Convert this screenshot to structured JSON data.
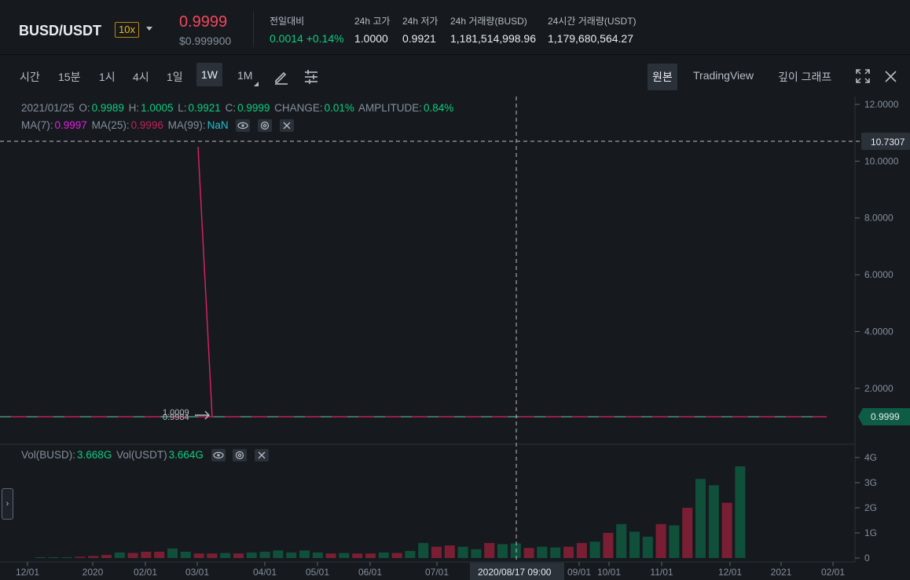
{
  "header": {
    "symbol": "BUSD/USDT",
    "leverage": "10x",
    "last_price": "0.9999",
    "usd_price": "$0.999900",
    "stats": [
      {
        "label": "전일대비",
        "value": "0.0014 +0.14%",
        "color": "#0ecb81"
      },
      {
        "label": "24h 고가",
        "value": "1.0000"
      },
      {
        "label": "24h 저가",
        "value": "0.9921"
      },
      {
        "label": "24h 거래량(BUSD)",
        "value": "1,181,514,998.96"
      },
      {
        "label": "24시간 거래량(USDT)",
        "value": "1,179,680,564.27"
      }
    ]
  },
  "toolbar": {
    "intervals": [
      "시간",
      "15분",
      "1시",
      "4시",
      "1일",
      "1W",
      "1M"
    ],
    "active_interval": "1W",
    "views": [
      "원본",
      "TradingView",
      "깊이 그래프"
    ],
    "active_view": "원본"
  },
  "ohlc": {
    "date": "2021/01/25",
    "o_label": "O:",
    "o": "0.9989",
    "h_label": "H:",
    "h": "1.0005",
    "l_label": "L:",
    "l": "0.9921",
    "c_label": "C:",
    "c": "0.9999",
    "change_label": "CHANGE:",
    "change": "0.01%",
    "amp_label": "AMPLITUDE:",
    "amp": "0.84%"
  },
  "ma": {
    "ma7_label": "MA(7):",
    "ma7": "0.9997",
    "ma7_color": "#e020e0",
    "ma25_label": "MA(25):",
    "ma25": "0.9996",
    "ma25_color": "#c0205a",
    "ma99_label": "MA(99):",
    "ma99": "NaN",
    "ma99_color": "#1ec0d0"
  },
  "volume_legend": {
    "busd_label": "Vol(BUSD):",
    "busd": "3.668G",
    "usdt_label": "Vol(USDT)",
    "usdt": "3.664G"
  },
  "chart_data": {
    "type": "bar",
    "price_axis": {
      "ticks": [
        "12.0000",
        "10.0000",
        "8.0000",
        "6.0000",
        "4.0000",
        "2.0000"
      ],
      "ylim": [
        0,
        12
      ]
    },
    "volume_axis": {
      "ticks": [
        "4G",
        "3G",
        "2G",
        "1G",
        "0"
      ],
      "ylim": [
        0,
        4
      ]
    },
    "x_ticks": [
      "12/01",
      "2020",
      "02/01",
      "03/01",
      "04/01",
      "05/01",
      "06/01",
      "07/01",
      "09/01",
      "10/01",
      "11/01",
      "12/01",
      "2021",
      "02/01"
    ],
    "crosshair": {
      "price_label": "10.7307",
      "date_label": "2020/08/17 09:00"
    },
    "last_price_label": "0.9999",
    "price_markers": [
      "1.0009",
      "0.9984"
    ],
    "volume_series": {
      "values": [
        0.0,
        0.02,
        0.03,
        0.05,
        0.08,
        0.12,
        0.22,
        0.2,
        0.25,
        0.25,
        0.38,
        0.25,
        0.18,
        0.18,
        0.2,
        0.18,
        0.22,
        0.25,
        0.3,
        0.22,
        0.3,
        0.22,
        0.18,
        0.2,
        0.18,
        0.18,
        0.22,
        0.2,
        0.28,
        0.6,
        0.45,
        0.5,
        0.45,
        0.35,
        0.6,
        0.55,
        0.58,
        0.4,
        0.45,
        0.42,
        0.45,
        0.6,
        0.65,
        1.0,
        1.35,
        1.05,
        0.85,
        1.35,
        1.3,
        2.0,
        3.15,
        2.9,
        2.2,
        3.65
      ],
      "up": [
        true,
        true,
        true,
        false,
        false,
        false,
        true,
        false,
        false,
        false,
        true,
        true,
        false,
        false,
        true,
        false,
        true,
        true,
        true,
        true,
        true,
        true,
        false,
        true,
        false,
        false,
        true,
        false,
        true,
        true,
        false,
        false,
        true,
        true,
        false,
        true,
        true,
        false,
        true,
        true,
        false,
        false,
        true,
        false,
        true,
        true,
        true,
        false,
        true,
        false,
        true,
        true,
        false,
        true
      ]
    }
  }
}
